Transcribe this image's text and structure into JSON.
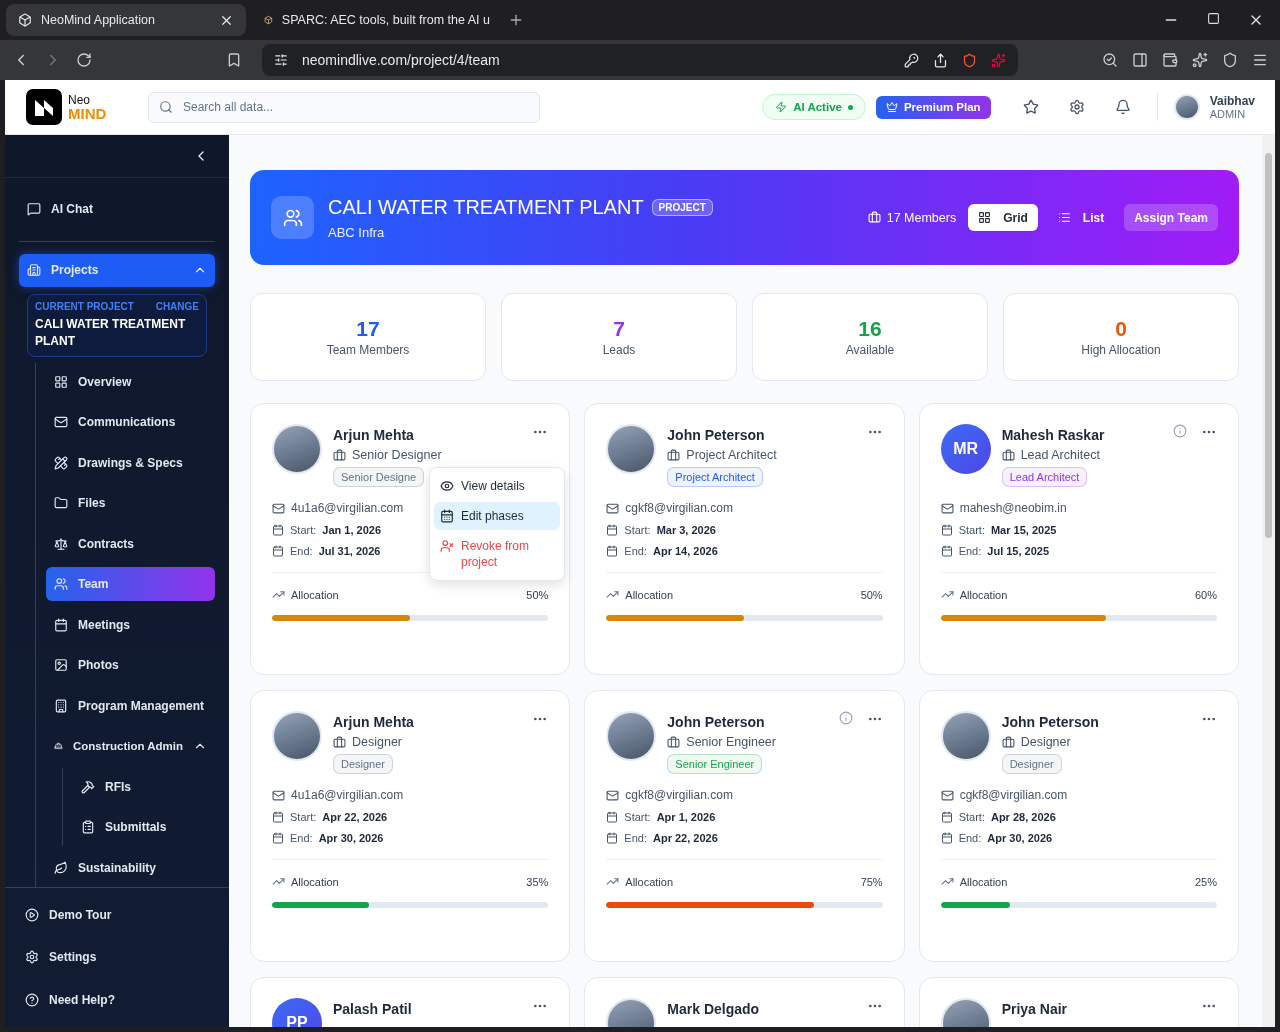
{
  "browser": {
    "tabs": [
      {
        "title": "NeoMind Application",
        "selected": true
      },
      {
        "title": "SPARC: AEC tools, built from the AI u",
        "selected": false
      }
    ],
    "url": "neomindlive.com/project/4/team"
  },
  "header": {
    "logo": {
      "line1": "Neo",
      "line2": "MIND"
    },
    "search": {
      "placeholder": "Search all data..."
    },
    "ai_status": {
      "label": "AI Active",
      "on": true
    },
    "plan": "Premium Plan",
    "user": {
      "name": "Vaibhav",
      "role": "ADMIN"
    }
  },
  "sidebar": {
    "top_items": [
      {
        "label": "AI Chat"
      }
    ],
    "projects": {
      "label": "Projects",
      "expanded": true,
      "current_project": {
        "caption": "CURRENT PROJECT",
        "action": "CHANGE",
        "name": "CALI WATER TREATMENT PLANT"
      },
      "items": [
        {
          "label": "Overview",
          "selected": false
        },
        {
          "label": "Communications",
          "selected": false
        },
        {
          "label": "Drawings & Specs",
          "selected": false
        },
        {
          "label": "Files",
          "selected": false
        },
        {
          "label": "Contracts",
          "selected": false
        },
        {
          "label": "Team",
          "selected": true
        },
        {
          "label": "Meetings",
          "selected": false
        },
        {
          "label": "Photos",
          "selected": false
        },
        {
          "label": "Program Management",
          "selected": false
        },
        {
          "label": "Construction Admin",
          "selected": false,
          "expanded": true,
          "children": [
            {
              "label": "RFIs",
              "selected": false
            },
            {
              "label": "Submittals",
              "selected": false
            }
          ]
        },
        {
          "label": "Sustainability",
          "selected": false
        }
      ]
    },
    "footer_items": [
      {
        "label": "Demo Tour"
      },
      {
        "label": "Settings"
      },
      {
        "label": "Need Help?"
      }
    ]
  },
  "hero": {
    "title": "CALI WATER TREATMENT PLANT",
    "badge": "PROJECT",
    "subtitle": "ABC Infra",
    "members": "17 Members",
    "views": [
      {
        "label": "Grid",
        "selected": true
      },
      {
        "label": "List",
        "selected": false
      }
    ],
    "action": "Assign Team"
  },
  "stats": [
    {
      "value": "17",
      "label": "Team Members",
      "color": "#1d5cf5"
    },
    {
      "value": "7",
      "label": "Leads",
      "color": "#9333ea"
    },
    {
      "value": "16",
      "label": "Available",
      "color": "#16a34a"
    },
    {
      "value": "0",
      "label": "High Allocation",
      "color": "#ea580c"
    }
  ],
  "members": [
    {
      "name": "Arjun Mehta",
      "avatar": {
        "kind": "photo"
      },
      "role": "Senior Designer",
      "chip": {
        "label": "Senior Designe",
        "color": "#64748b"
      },
      "email": "4u1a6@virgilian.com",
      "start_label": "Start:",
      "start": "Jan 1, 2026",
      "end_label": "End:",
      "end": "Jul 31, 2026",
      "allocation": {
        "label": "Allocation",
        "reading": "50%",
        "level": 0.5,
        "color": "#d4870a"
      },
      "info_icon": false,
      "menu": [
        {
          "label": "View details",
          "kind": "normal",
          "selected": false
        },
        {
          "label": "Edit phases",
          "kind": "normal",
          "selected": true
        },
        {
          "label": "Revoke from project",
          "kind": "danger",
          "selected": false
        }
      ]
    },
    {
      "name": "John Peterson",
      "avatar": {
        "kind": "photo"
      },
      "role": "Project Architect",
      "chip": {
        "label": "Project Architect",
        "color": "#1d5cf5"
      },
      "email": "cgkf8@virgilian.com",
      "start_label": "Start:",
      "start": "Mar 3, 2026",
      "end_label": "End:",
      "end": "Apr 14, 2026",
      "allocation": {
        "label": "Allocation",
        "reading": "50%",
        "level": 0.5,
        "color": "#d4870a"
      },
      "info_icon": false
    },
    {
      "name": "Mahesh Raskar",
      "avatar": {
        "kind": "initials",
        "initials": "MR"
      },
      "role": "Lead Architect",
      "chip": {
        "label": "Lead Architect",
        "color": "#9333ea"
      },
      "email": "mahesh@neobim.in",
      "start_label": "Start:",
      "start": "Mar 15, 2025",
      "end_label": "End:",
      "end": "Jul 15, 2025",
      "allocation": {
        "label": "Allocation",
        "reading": "60%",
        "level": 0.6,
        "color": "#d4870a"
      },
      "info_icon": true
    },
    {
      "name": "Arjun Mehta",
      "avatar": {
        "kind": "photo"
      },
      "role": "Designer",
      "chip": {
        "label": "Designer",
        "color": "#64748b"
      },
      "email": "4u1a6@virgilian.com",
      "start_label": "Start:",
      "start": "Apr 22, 2026",
      "end_label": "End:",
      "end": "Apr 30, 2026",
      "allocation": {
        "label": "Allocation",
        "reading": "35%",
        "level": 0.35,
        "color": "#16a34a"
      },
      "info_icon": false
    },
    {
      "name": "John Peterson",
      "avatar": {
        "kind": "photo"
      },
      "role": "Senior Engineer",
      "chip": {
        "label": "Senior Engineer",
        "color": "#16a34a"
      },
      "email": "cgkf8@virgilian.com",
      "start_label": "Start:",
      "start": "Apr 1, 2026",
      "end_label": "End:",
      "end": "Apr 22, 2026",
      "allocation": {
        "label": "Allocation",
        "reading": "75%",
        "level": 0.75,
        "color": "#ea4b0c"
      },
      "info_icon": true
    },
    {
      "name": "John Peterson",
      "avatar": {
        "kind": "photo"
      },
      "role": "Designer",
      "chip": {
        "label": "Designer",
        "color": "#64748b"
      },
      "email": "cgkf8@virgilian.com",
      "start_label": "Start:",
      "start": "Apr 28, 2026",
      "end_label": "End:",
      "end": "Apr 30, 2026",
      "allocation": {
        "label": "Allocation",
        "reading": "25%",
        "level": 0.25,
        "color": "#16a34a"
      },
      "info_icon": false
    },
    {
      "name": "Palash Patil",
      "avatar": {
        "kind": "initials",
        "initials": "PP"
      },
      "info_icon": false
    },
    {
      "name": "Mark Delgado",
      "avatar": {
        "kind": "photo"
      },
      "info_icon": false
    },
    {
      "name": "Priya Nair",
      "avatar": {
        "kind": "photo"
      },
      "info_icon": false
    }
  ]
}
